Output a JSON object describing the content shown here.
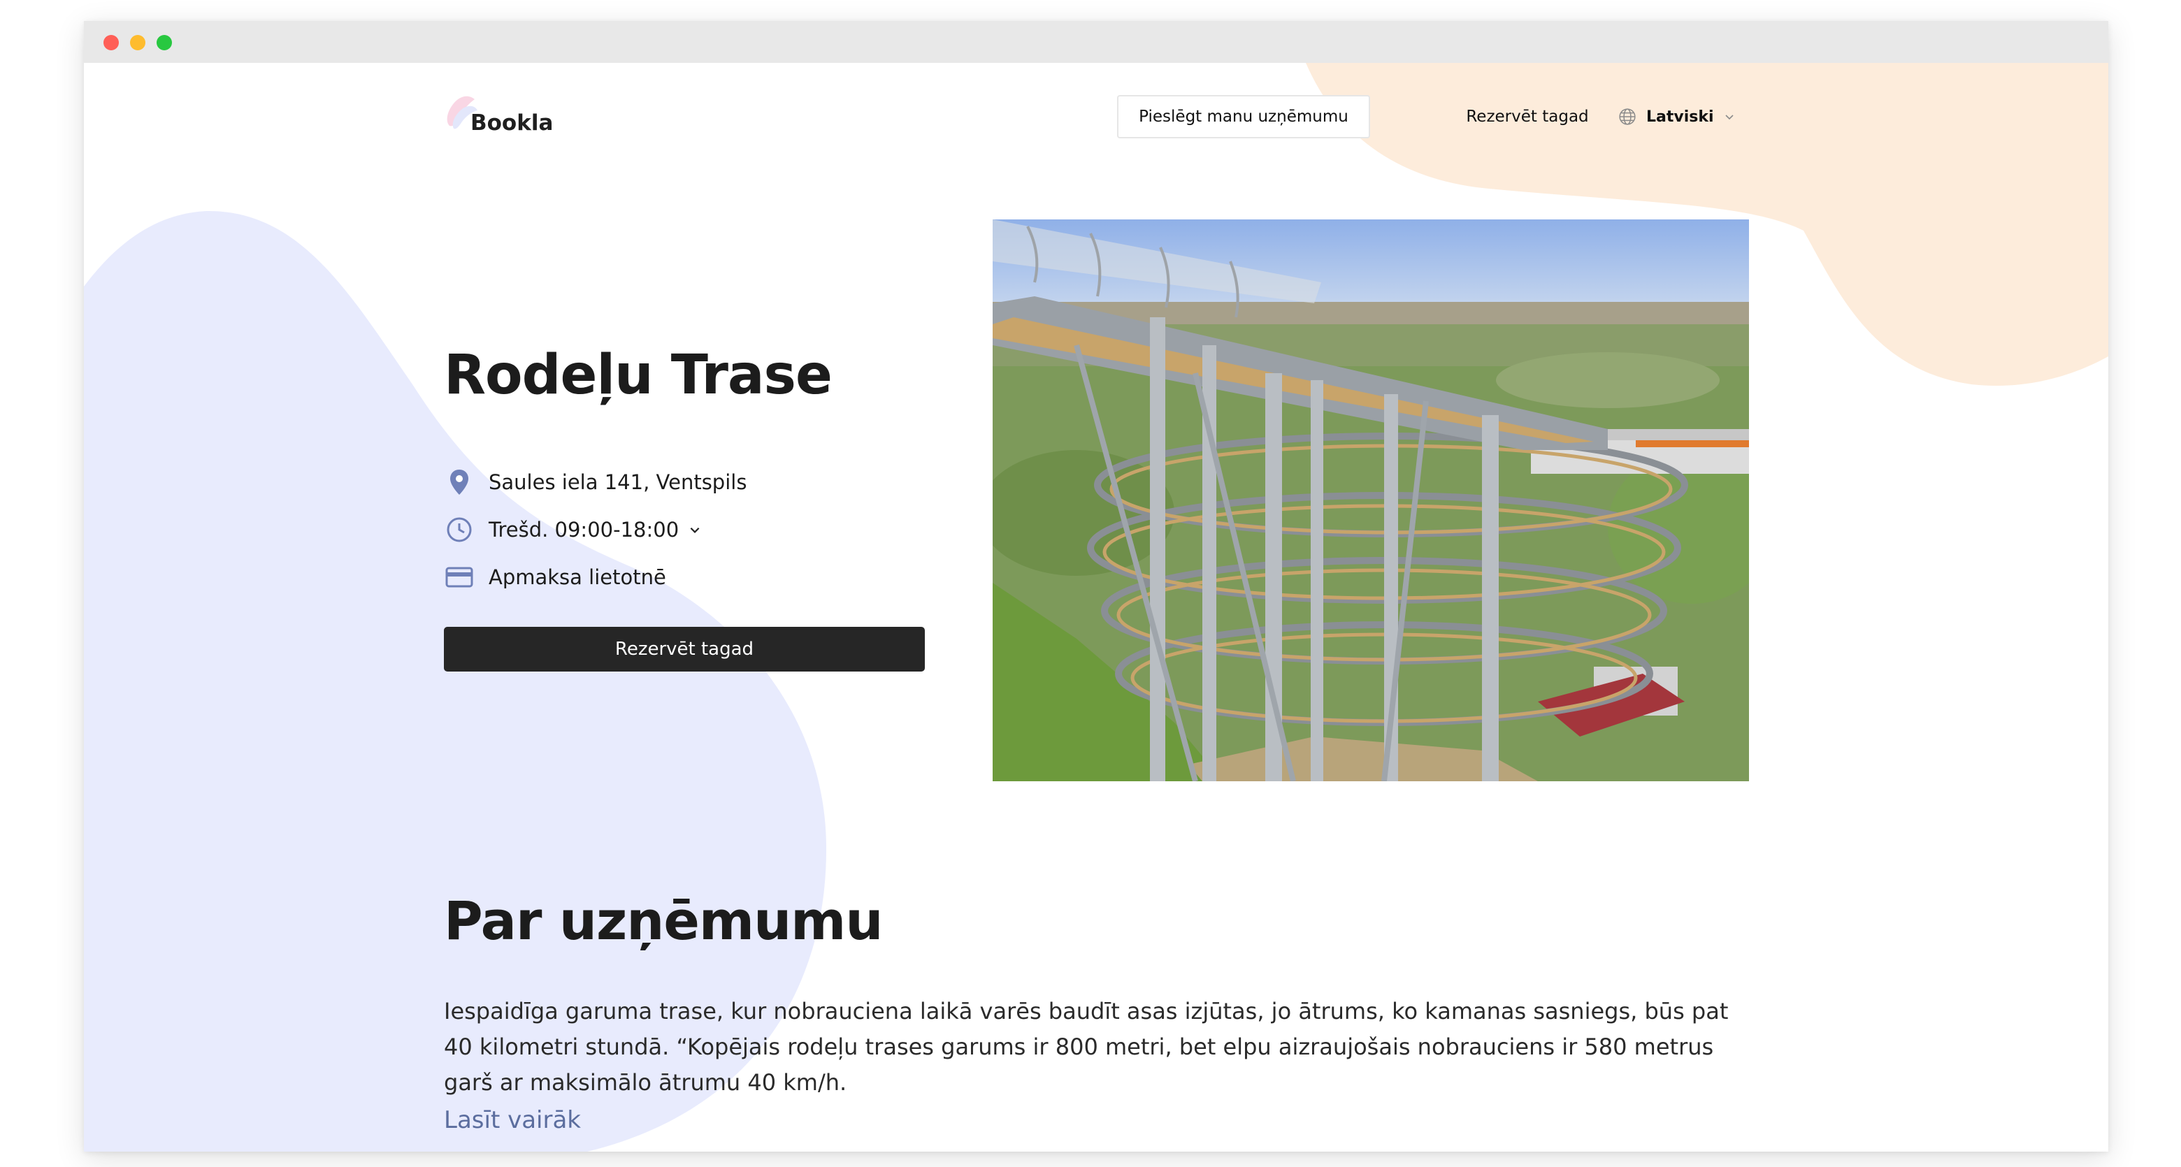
{
  "header": {
    "logo_text": "Bookla",
    "connect_label": "Pieslēgt manu uzņēmumu",
    "book_label": "Rezervēt tagad",
    "language": "Latviski"
  },
  "venue": {
    "name": "Rodeļu Trase",
    "address": "Saules iela 141, Ventspils",
    "hours": "Trešd. 09:00-18:00",
    "payment": "Apmaksa lietotnē",
    "book_button": "Rezervēt tagad"
  },
  "about": {
    "title": "Par uzņēmumu",
    "text": "Iespaidīga garuma trase, kur nobrauciena laikā varēs baudīt asas izjūtas, jo ātrums, ko kamanas sasniegs, būs pat 40 kilometri stundā. “Kopējais rodeļu trases garums ir 800 metri, bet elpu aizraujošais nobrauciens ir 580 metrus garš ar maksimālo ātrumu 40 km/h.",
    "read_more": "Lasīt vairāk"
  },
  "icons": {
    "address": "location-pin-icon",
    "hours": "clock-icon",
    "payment": "credit-card-icon",
    "language": "globe-icon"
  },
  "colors": {
    "accent_blue": "#6f80b8",
    "blob_blue": "#e8ebfd",
    "blob_peach": "#fdecdb",
    "button_dark": "#262626",
    "link": "#5b6d9e"
  }
}
